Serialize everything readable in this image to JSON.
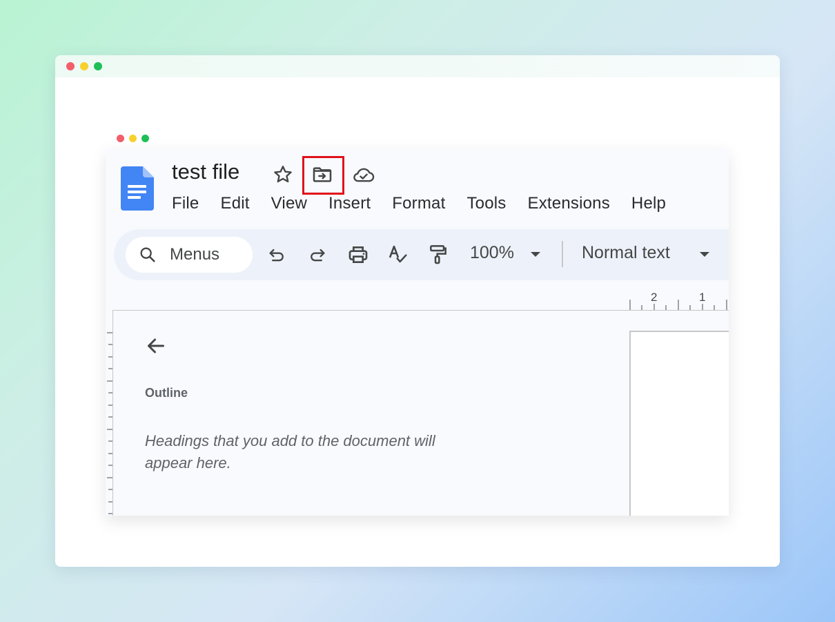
{
  "outer_window": {
    "traffic_lights": [
      "close",
      "minimize",
      "maximize"
    ]
  },
  "app_window": {
    "traffic_lights": [
      "close",
      "minimize",
      "maximize"
    ]
  },
  "header": {
    "app_icon": "google-docs-icon",
    "title": "test file",
    "icons": [
      {
        "name": "star-icon",
        "label": "Star"
      },
      {
        "name": "move-icon",
        "label": "Move",
        "highlighted": true
      },
      {
        "name": "cloud-saved-icon",
        "label": "Document status"
      }
    ],
    "highlight_color": "#e0111a"
  },
  "menubar": {
    "items": [
      "File",
      "Edit",
      "View",
      "Insert",
      "Format",
      "Tools",
      "Extensions",
      "Help"
    ]
  },
  "toolbar": {
    "search_label": "Menus",
    "buttons": [
      "undo-icon",
      "redo-icon",
      "print-icon",
      "spellcheck-icon",
      "paint-format-icon"
    ],
    "zoom_value": "100%",
    "style_value": "Normal text"
  },
  "ruler": {
    "labels": [
      "2",
      "1"
    ]
  },
  "outline": {
    "heading": "Outline",
    "empty_message": "Headings that you add to the document will appear here."
  },
  "colors": {
    "docs_blue": "#4285f4",
    "toolbar_bg": "#edf2fa",
    "app_bg": "#f8fafd"
  }
}
